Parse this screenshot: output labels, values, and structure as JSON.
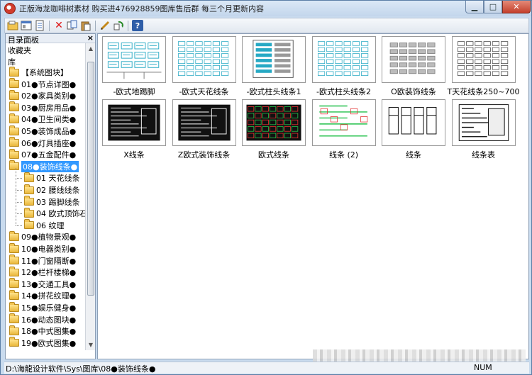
{
  "window": {
    "title": "正版海龙咖啡树素材 购买进476928859图库售后群 每三个月更新内容"
  },
  "left_panel": {
    "header": "目录面板",
    "rows": [
      "收藏夹",
      "库"
    ],
    "tree": [
      {
        "label": "【系统图块】",
        "level": 0
      },
      {
        "label": "01●节点详图●",
        "level": 0
      },
      {
        "label": "02●家具类别●",
        "level": 0
      },
      {
        "label": "03●厨房用品●",
        "level": 0
      },
      {
        "label": "04●卫生间类●",
        "level": 0
      },
      {
        "label": "05●装饰成品●",
        "level": 0
      },
      {
        "label": "06●灯具插座●",
        "level": 0
      },
      {
        "label": "07●五金配件●",
        "level": 0
      },
      {
        "label": "08●装饰线条●",
        "level": 0,
        "selected": true
      },
      {
        "label": "01 天花线条",
        "level": 1
      },
      {
        "label": "02 腰线线条",
        "level": 1
      },
      {
        "label": "03 踢脚线条",
        "level": 1
      },
      {
        "label": "04 欧式顶饰石膏",
        "level": 1
      },
      {
        "label": "06 纹理",
        "level": 1
      },
      {
        "label": "09●植物景观●",
        "level": 0
      },
      {
        "label": "10●电器类别●",
        "level": 0
      },
      {
        "label": "11●门窗隔断●",
        "level": 0
      },
      {
        "label": "12●栏杆楼梯●",
        "level": 0
      },
      {
        "label": "13●交通工具●",
        "level": 0
      },
      {
        "label": "14●拼花纹理●",
        "level": 0
      },
      {
        "label": "15●娱乐健身●",
        "level": 0
      },
      {
        "label": "16●动态图块●",
        "level": 0
      },
      {
        "label": "18●中式图集●",
        "level": 0
      },
      {
        "label": "19●欧式图集●",
        "level": 0
      }
    ]
  },
  "thumbnails": [
    {
      "label": "-欧式地踢脚",
      "style": "boxes",
      "accent": "#27a9c4"
    },
    {
      "label": "-欧式天花线条",
      "style": "grid",
      "accent": "#27a9c4"
    },
    {
      "label": "-欧式柱头线条1",
      "style": "sheet",
      "accent": "#27a9c4"
    },
    {
      "label": "-欧式柱头线条2",
      "style": "grid",
      "accent": "#27a9c4"
    },
    {
      "label": "O欧装饰线条",
      "style": "gray",
      "accent": "#888888"
    },
    {
      "label": "T天花线条250~700",
      "style": "grid",
      "accent": "#444444"
    },
    {
      "label": "X线条",
      "style": "blackdoc",
      "accent": "#ffffff"
    },
    {
      "label": "Z欧式装饰线条",
      "style": "blackdoc",
      "accent": "#ffffff"
    },
    {
      "label": "欧式线条",
      "style": "redgreen",
      "accent": "#e23030"
    },
    {
      "label": "线条 (2)",
      "style": "green",
      "accent": "#22c04a"
    },
    {
      "label": "线条",
      "style": "bw",
      "accent": "#000000"
    },
    {
      "label": "线条表",
      "style": "bw2",
      "accent": "#000000"
    }
  ],
  "statusbar": {
    "path": "D:\\海龍设计软件\\Sys\\图库\\08●装饰线条●",
    "num": "NUM"
  }
}
